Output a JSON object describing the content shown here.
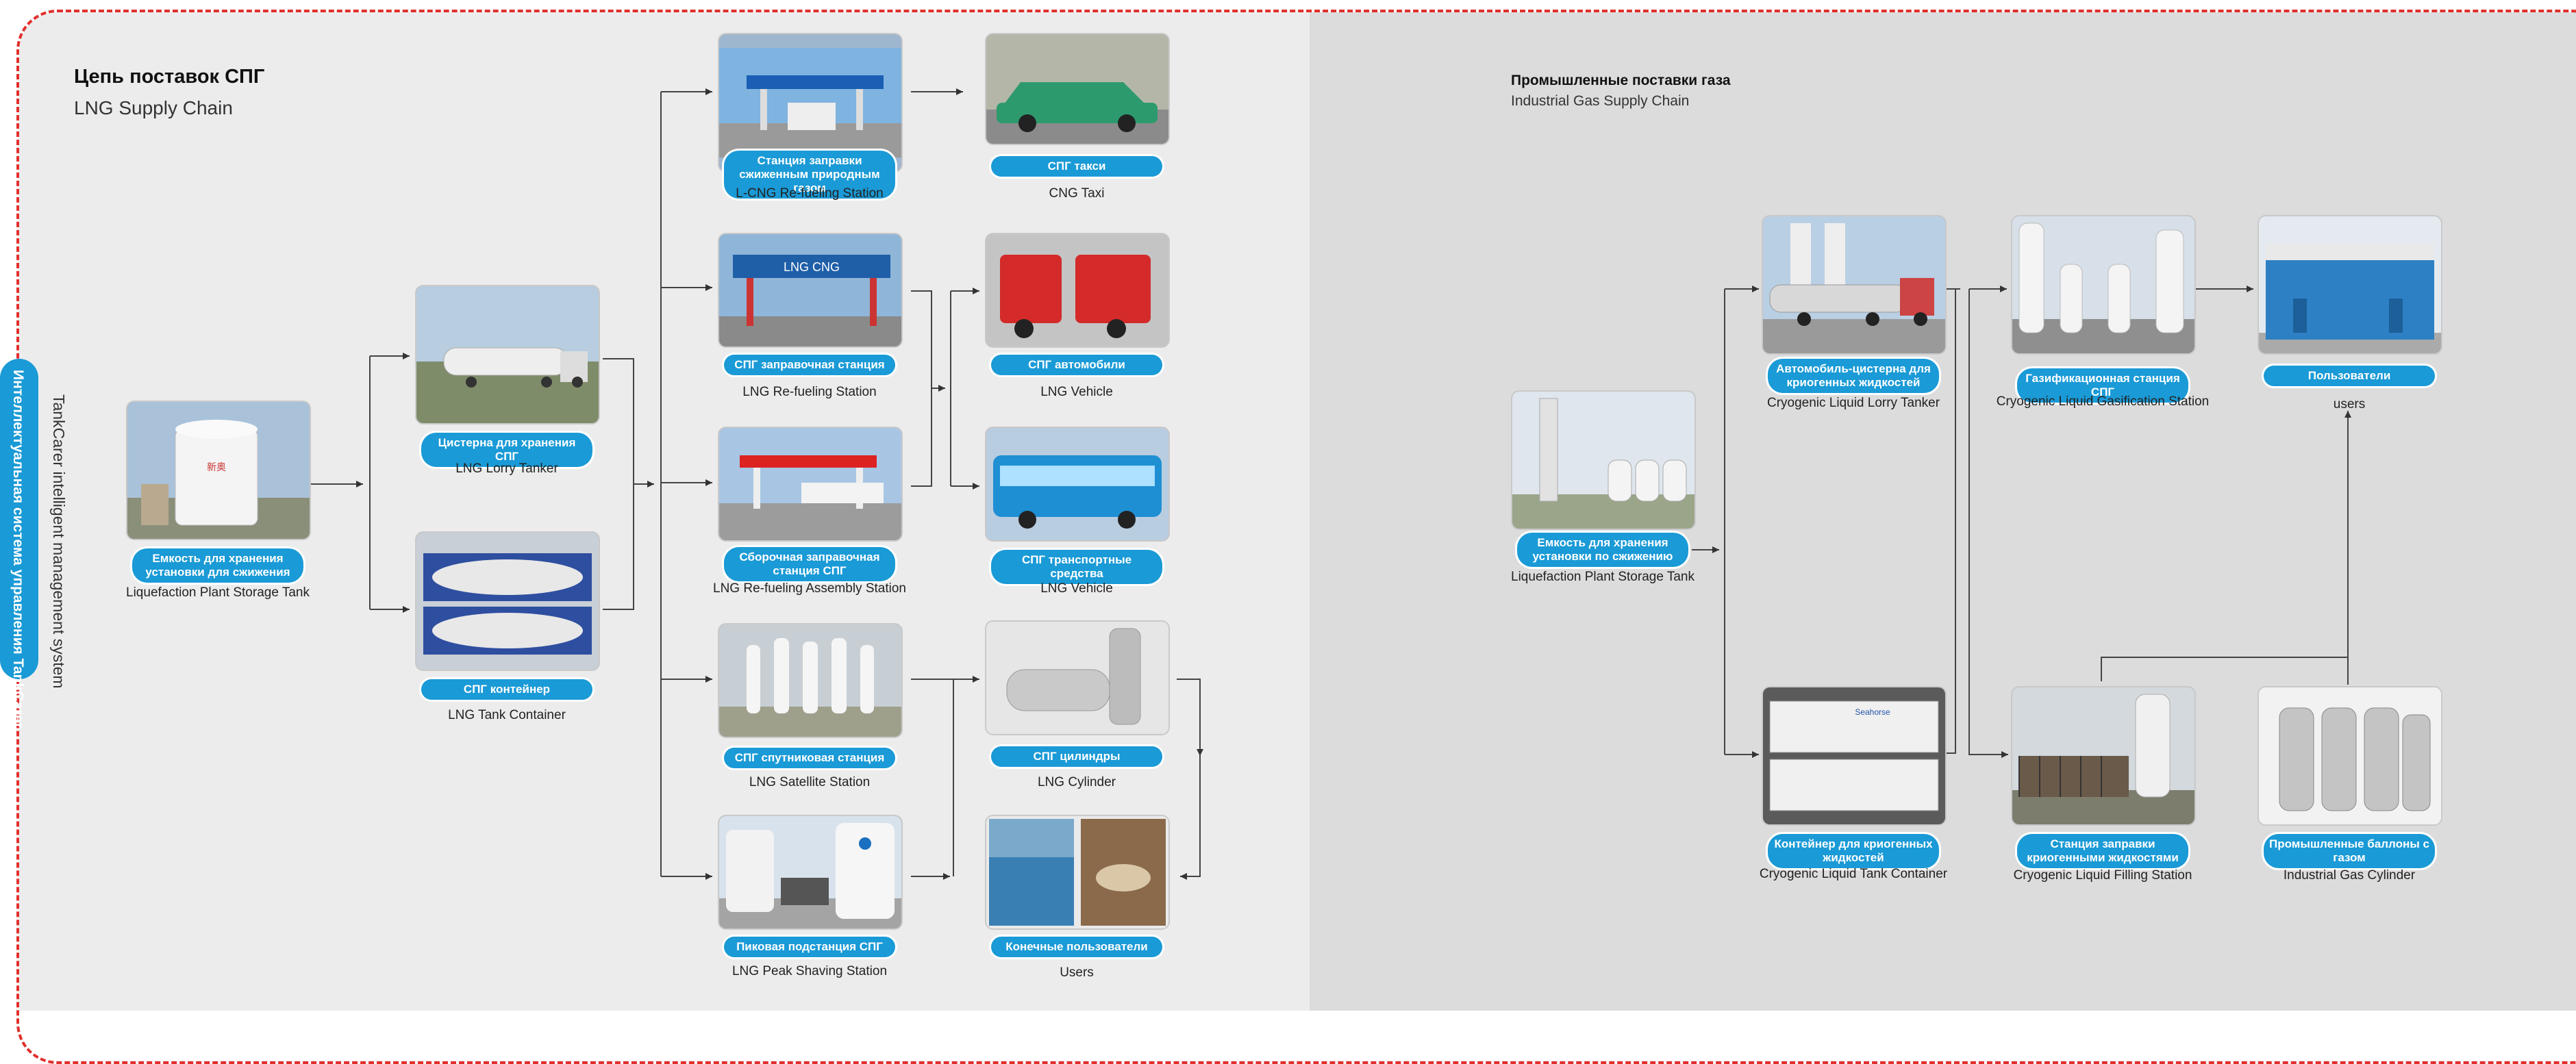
{
  "side": {
    "ru": "Интеллектуальная система управления TankCarer",
    "en": "TankCarer intelligent management system"
  },
  "lng": {
    "title_ru": "Цепь поставок СПГ",
    "title_en": "LNG Supply Chain",
    "nodes": [
      {
        "ru": "Емкость для хранения установки для сжижения",
        "en": "Liquefaction Plant Storage Tank",
        "icon": "storage-tank-photo"
      },
      {
        "ru": "Цистерна для хранения СПГ",
        "en": "LNG Lorry Tanker",
        "icon": "lorry-tanker-photo"
      },
      {
        "ru": "СПГ контейнер",
        "en": "LNG Tank Container",
        "icon": "tank-container-photo"
      },
      {
        "ru": "Станция заправки сжиженным природным газом",
        "en": "L-CNG  Re-fueling Station",
        "icon": "refueling-station-photo"
      },
      {
        "ru": "СПГ заправочная станция",
        "en": "LNG Re-fueling Station",
        "icon": "refueling-station-photo"
      },
      {
        "ru": "Сборочная заправочная станция СПГ",
        "en": "LNG Re-fueling Assembly Station",
        "icon": "assembly-station-photo"
      },
      {
        "ru": "СПГ спутниковая станция",
        "en": "LNG Satellite Station",
        "icon": "satellite-station-photo"
      },
      {
        "ru": "Пиковая подстанция СПГ",
        "en": "LNG Peak Shaving Station",
        "icon": "peak-shaving-photo"
      },
      {
        "ru": "СПГ такси",
        "en": "CNG Taxi",
        "icon": "taxi-photo"
      },
      {
        "ru": "СПГ автомобили",
        "en": "LNG Vehicle",
        "icon": "truck-photo"
      },
      {
        "ru": "СПГ транспортные средства",
        "en": "LNG Vehicle",
        "icon": "bus-photo"
      },
      {
        "ru": "СПГ цилиндры",
        "en": "LNG Cylinder",
        "icon": "cylinder-photo"
      },
      {
        "ru": "Конечные пользователи",
        "en": "Users",
        "icon": "end-users-photo"
      }
    ]
  },
  "ind": {
    "title_ru": "Промышленные поставки газа",
    "title_en": "Industrial Gas Supply Chain",
    "nodes": [
      {
        "ru": "Емкость для хранения установки по сжижению",
        "en": "Liquefaction Plant Storage Tank",
        "icon": "plant-tower-photo"
      },
      {
        "ru": "Автомобиль-цистерна для криогенных жидкостей",
        "en": "Cryogenic Liquid Lorry Tanker",
        "icon": "lorry-tanker-photo"
      },
      {
        "ru": "Контейнер для криогенных жидкостей",
        "en": "Cryogenic Liquid Tank Container",
        "icon": "tank-container-photo"
      },
      {
        "ru": "Газификационная станция СПГ",
        "en": "Cryogenic Liquid Gasification Station",
        "icon": "gasification-station-photo"
      },
      {
        "ru": "Станция заправки криогенными жидкостями",
        "en": "Cryogenic Liquid Filling Station",
        "icon": "filling-station-photo"
      },
      {
        "ru": "Пользователи",
        "en": "users",
        "icon": "warehouse-photo"
      },
      {
        "ru": "Промышленные баллоны с газом",
        "en": "Industrial Gas Cylinder",
        "icon": "gas-cylinders-photo"
      }
    ]
  },
  "colors": {
    "accent": "#1a9ad6",
    "frame": "#e0302e",
    "panel_left": "#ececec",
    "panel_right": "#dcdcdc"
  }
}
